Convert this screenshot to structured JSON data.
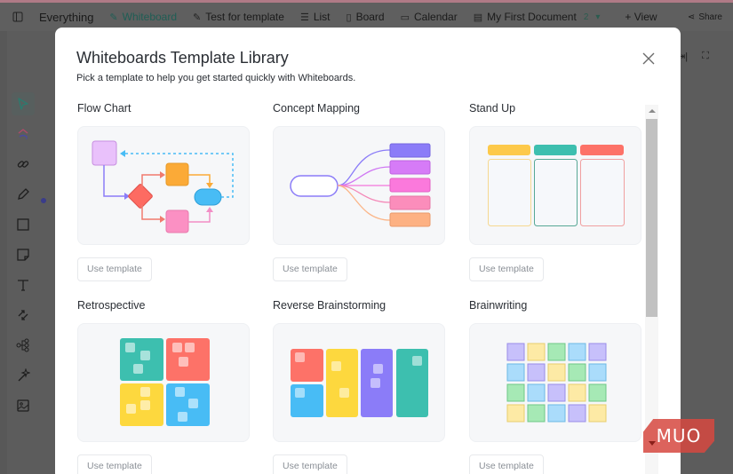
{
  "topbar": {
    "sidebar_toggle_icon": "sidebar-toggle-icon",
    "workspace": "Everything",
    "tabs": [
      {
        "label": "Whiteboard",
        "icon": "whiteboard-icon",
        "active": true
      },
      {
        "label": "Test for template",
        "icon": "whiteboard-icon",
        "active": false
      },
      {
        "label": "List",
        "icon": "list-icon",
        "active": false
      },
      {
        "label": "Board",
        "icon": "board-icon",
        "active": false
      },
      {
        "label": "Calendar",
        "icon": "calendar-icon",
        "active": false
      },
      {
        "label": "My First Document",
        "icon": "document-icon",
        "active": false,
        "count": "2"
      }
    ],
    "add_view": "+ View",
    "share": "Share"
  },
  "toolbar": {
    "tools": [
      "select",
      "templates",
      "link",
      "pen",
      "rectangle",
      "sticky-note",
      "text",
      "connector",
      "mind-map",
      "ai-magic",
      "image"
    ]
  },
  "modal": {
    "title": "Whiteboards Template Library",
    "subtitle": "Pick a template to help you get started quickly with Whiteboards.",
    "close_label": "×",
    "templates": [
      {
        "name": "Flow Chart",
        "button": "Use template"
      },
      {
        "name": "Concept Mapping",
        "button": "Use template"
      },
      {
        "name": "Stand Up",
        "button": "Use template"
      },
      {
        "name": "Retrospective",
        "button": "Use template"
      },
      {
        "name": "Reverse Brainstorming",
        "button": "Use template"
      },
      {
        "name": "Brainwriting",
        "button": "Use template"
      }
    ]
  },
  "watermark": "MUO",
  "colors": {
    "accent": "#2d7a6e",
    "purple": "#8b7cf8",
    "teal": "#3dbfaf",
    "coral": "#fd7268",
    "yellow": "#fdd33e",
    "blue": "#48bcf5",
    "pink": "#fb8fc3",
    "orange": "#fbaa37"
  }
}
